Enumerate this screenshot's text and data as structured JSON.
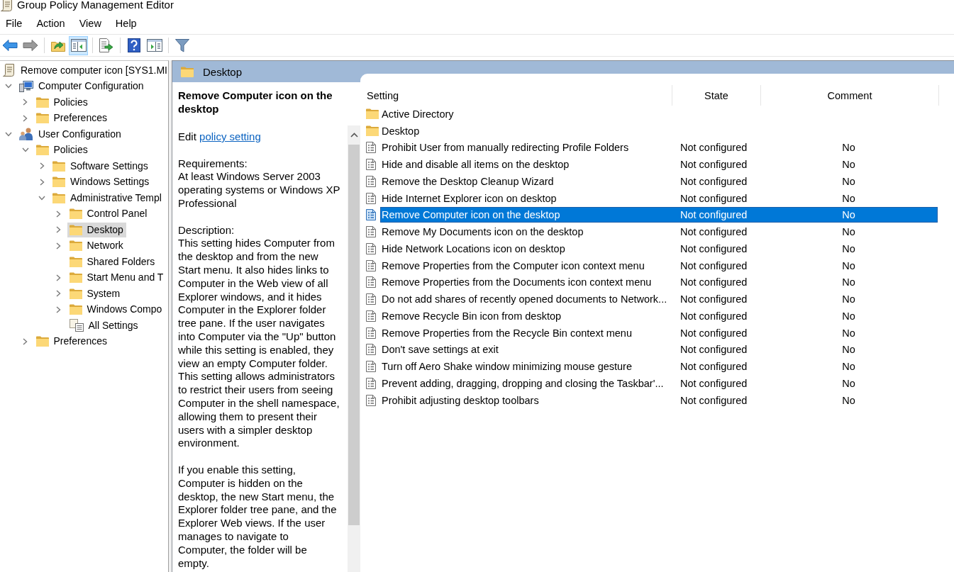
{
  "window": {
    "title": "Group Policy Management Editor"
  },
  "menu": [
    "File",
    "Action",
    "View",
    "Help"
  ],
  "toolbar": [
    {
      "buttons": [
        {
          "kind": "back",
          "pressed": false,
          "disabled": false
        },
        {
          "kind": "forward",
          "pressed": false,
          "disabled": true
        }
      ]
    },
    {
      "buttons": [
        {
          "kind": "up",
          "pressed": false,
          "disabled": false
        },
        {
          "kind": "console-tree",
          "pressed": true,
          "disabled": false
        }
      ]
    },
    {
      "buttons": [
        {
          "kind": "export",
          "pressed": false,
          "disabled": false
        }
      ]
    },
    {
      "buttons": [
        {
          "kind": "help",
          "pressed": false,
          "disabled": false
        },
        {
          "kind": "action-pane",
          "pressed": false,
          "disabled": false
        }
      ]
    },
    {
      "buttons": [
        {
          "kind": "filter",
          "pressed": false,
          "disabled": false
        }
      ]
    }
  ],
  "tree": [
    {
      "label": "Remove computer icon [SYS1.MI",
      "kind": "gpo",
      "selected": false,
      "children": [
        {
          "label": "Computer Configuration",
          "kind": "computer",
          "expanded": true,
          "selected": false,
          "children": [
            {
              "label": "Policies",
              "kind": "folder",
              "expanded": false,
              "selected": false
            },
            {
              "label": "Preferences",
              "kind": "folder",
              "expanded": false,
              "selected": false
            }
          ]
        },
        {
          "label": "User Configuration",
          "kind": "users",
          "expanded": true,
          "selected": false,
          "children": [
            {
              "label": "Policies",
              "kind": "folder",
              "expanded": true,
              "selected": false,
              "children": [
                {
                  "label": "Software Settings",
                  "kind": "folder",
                  "expanded": false,
                  "selected": false
                },
                {
                  "label": "Windows Settings",
                  "kind": "folder",
                  "expanded": false,
                  "selected": false
                },
                {
                  "label": "Administrative Templ",
                  "kind": "folder",
                  "expanded": true,
                  "selected": false,
                  "children": [
                    {
                      "label": "Control Panel",
                      "kind": "folder",
                      "expanded": false,
                      "selected": false
                    },
                    {
                      "label": "Desktop",
                      "kind": "folder",
                      "expanded": false,
                      "selected": true
                    },
                    {
                      "label": "Network",
                      "kind": "folder",
                      "expanded": false,
                      "selected": false
                    },
                    {
                      "label": "Shared Folders",
                      "kind": "folder",
                      "selected": false
                    },
                    {
                      "label": "Start Menu and T",
                      "kind": "folder",
                      "expanded": false,
                      "selected": false
                    },
                    {
                      "label": "System",
                      "kind": "folder",
                      "expanded": false,
                      "selected": false
                    },
                    {
                      "label": "Windows Compo",
                      "kind": "folder",
                      "expanded": false,
                      "selected": false
                    },
                    {
                      "label": "All Settings",
                      "kind": "all-settings",
                      "selected": false
                    }
                  ]
                }
              ]
            },
            {
              "label": "Preferences",
              "kind": "folder",
              "expanded": false,
              "selected": false
            }
          ]
        }
      ]
    }
  ],
  "details": {
    "header": "Desktop",
    "title": "Remove Computer icon on the desktop",
    "edit_text": "Edit",
    "link": "policy setting",
    "requirements_label": "Requirements:",
    "requirements": "At least Windows Server 2003 operating systems or Windows XP Professional",
    "description_label": "Description:",
    "paragraphs": [
      "This setting hides Computer from the desktop and from the new Start menu. It also hides links to Computer in the Web view of all Explorer windows, and it hides Computer in the Explorer folder tree pane. If the user navigates into Computer via the \"Up\" button while this setting is enabled, they view an empty Computer folder. This setting allows administrators to restrict their users from seeing Computer in the shell namespace, allowing them to present their users with a simpler desktop environment.",
      "If you enable this setting, Computer is hidden on the desktop, the new Start menu, the Explorer folder tree pane, and the Explorer Web views. If the user manages to navigate to Computer, the folder will be empty."
    ]
  },
  "settings": {
    "columns": [
      "Setting",
      "State",
      "Comment"
    ],
    "rows": [
      {
        "kind": "folder",
        "name": "Active Directory",
        "selected": false
      },
      {
        "kind": "folder",
        "name": "Desktop",
        "selected": false
      },
      {
        "kind": "policy",
        "name": "Prohibit User from manually redirecting Profile Folders",
        "state": "Not configured",
        "comment": "No",
        "selected": false
      },
      {
        "kind": "policy",
        "name": "Hide and disable all items on the desktop",
        "state": "Not configured",
        "comment": "No",
        "selected": false
      },
      {
        "kind": "policy",
        "name": "Remove the Desktop Cleanup Wizard",
        "state": "Not configured",
        "comment": "No",
        "selected": false
      },
      {
        "kind": "policy",
        "name": "Hide Internet Explorer icon on desktop",
        "state": "Not configured",
        "comment": "No",
        "selected": false
      },
      {
        "kind": "policy",
        "name": "Remove Computer icon on the desktop",
        "state": "Not configured",
        "comment": "No",
        "selected": true
      },
      {
        "kind": "policy",
        "name": "Remove My Documents icon on the desktop",
        "state": "Not configured",
        "comment": "No",
        "selected": false
      },
      {
        "kind": "policy",
        "name": "Hide Network Locations icon on desktop",
        "state": "Not configured",
        "comment": "No",
        "selected": false
      },
      {
        "kind": "policy",
        "name": "Remove Properties from the Computer icon context menu",
        "state": "Not configured",
        "comment": "No",
        "selected": false
      },
      {
        "kind": "policy",
        "name": "Remove Properties from the Documents icon context menu",
        "state": "Not configured",
        "comment": "No",
        "selected": false
      },
      {
        "kind": "policy",
        "name": "Do not add shares of recently opened documents to Network...",
        "state": "Not configured",
        "comment": "No",
        "selected": false
      },
      {
        "kind": "policy",
        "name": "Remove Recycle Bin icon from desktop",
        "state": "Not configured",
        "comment": "No",
        "selected": false
      },
      {
        "kind": "policy",
        "name": "Remove Properties from the Recycle Bin context menu",
        "state": "Not configured",
        "comment": "No",
        "selected": false
      },
      {
        "kind": "policy",
        "name": "Don't save settings at exit",
        "state": "Not configured",
        "comment": "No",
        "selected": false
      },
      {
        "kind": "policy",
        "name": "Turn off Aero Shake window minimizing mouse gesture",
        "state": "Not configured",
        "comment": "No",
        "selected": false
      },
      {
        "kind": "policy",
        "name": "Prevent adding, dragging, dropping and closing the Taskbar'...",
        "state": "Not configured",
        "comment": "No",
        "selected": false
      },
      {
        "kind": "policy",
        "name": "Prohibit adjusting desktop toolbars",
        "state": "Not configured",
        "comment": "No",
        "selected": false
      }
    ]
  }
}
